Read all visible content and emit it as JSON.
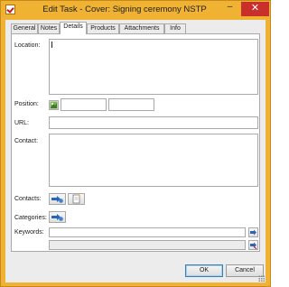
{
  "window": {
    "title": "Edit Task - Cover: Signing ceremony NSTP",
    "minimize_glyph": "–",
    "close_glyph": "✕",
    "colors": {
      "frame": "#f0b233",
      "close": "#c9302c",
      "client": "#ececec"
    }
  },
  "tabs": [
    {
      "label": "General"
    },
    {
      "label": "Notes"
    },
    {
      "label": "Details",
      "active": true
    },
    {
      "label": "Products"
    },
    {
      "label": "Attachments"
    },
    {
      "label": "Info"
    }
  ],
  "form": {
    "location_label": "Location:",
    "location_value": "",
    "position_label": "Position:",
    "position_x_value": "",
    "position_y_value": "",
    "url_label": "URL:",
    "url_value": "",
    "contact_label": "Contact:",
    "contact_value": "",
    "contacts_label": "Contacts:",
    "categories_label": "Categories:",
    "keywords_label": "Keywords:",
    "keywords_value": "",
    "keywords_extra_value": ""
  },
  "icons": {
    "position": "map-pin-icon",
    "contacts_add": "contact-arrow-icon",
    "contacts_note": "notepad-icon",
    "categories": "category-arrow-icon",
    "keywords_add": "keyword-arrow-icon",
    "keywords_remove": "keyword-remove-icon"
  },
  "footer": {
    "ok_label": "OK",
    "cancel_label": "Cancel"
  }
}
